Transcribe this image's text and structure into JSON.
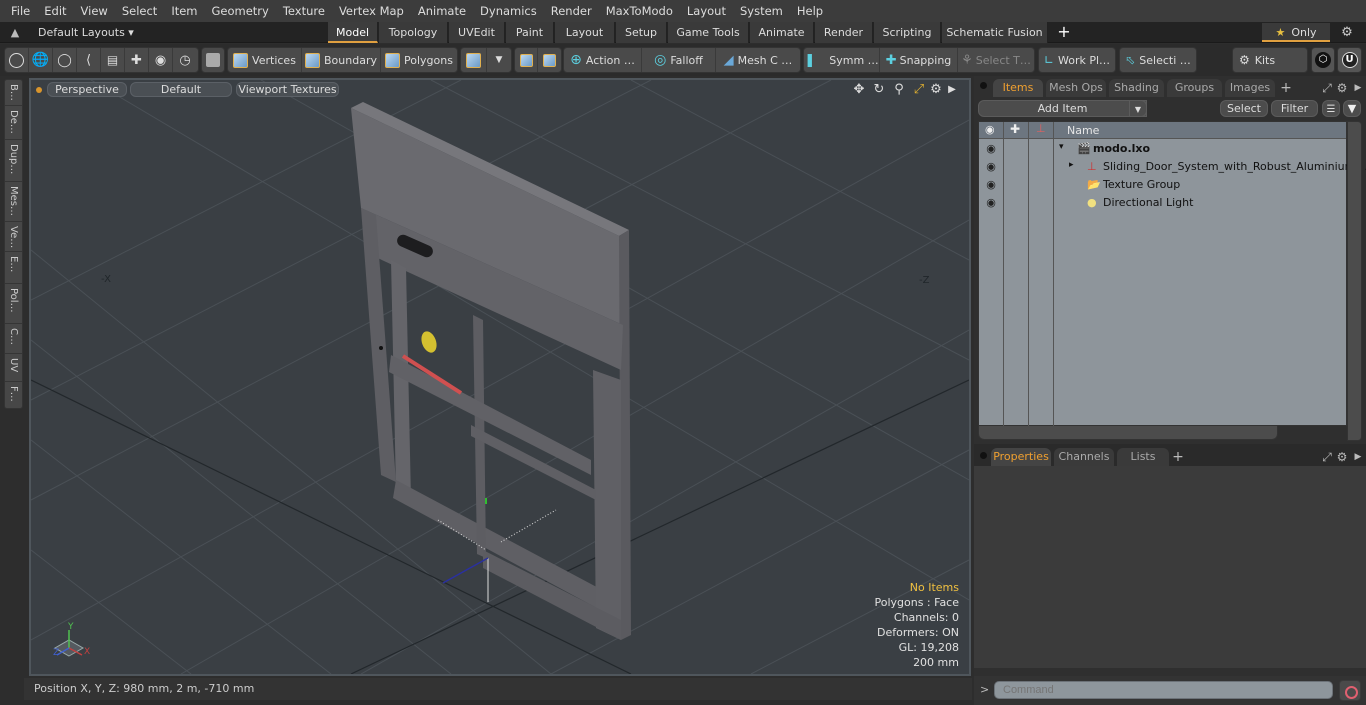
{
  "menubar": {
    "items": [
      "File",
      "Edit",
      "View",
      "Select",
      "Item",
      "Geometry",
      "Texture",
      "Vertex Map",
      "Animate",
      "Dynamics",
      "Render",
      "MaxToModo",
      "Layout",
      "System",
      "Help"
    ]
  },
  "layout_bar": {
    "layouts_dropdown": "Default Layouts ▾",
    "tabs": [
      {
        "label": "Model",
        "active": true
      },
      {
        "label": "Topology"
      },
      {
        "label": "UVEdit"
      },
      {
        "label": "Paint"
      },
      {
        "label": "Layout"
      },
      {
        "label": "Setup"
      },
      {
        "label": "Game Tools"
      },
      {
        "label": "Animate"
      },
      {
        "label": "Render"
      },
      {
        "label": "Scripting"
      },
      {
        "label": "Schematic Fusion"
      }
    ],
    "add_tab": "+",
    "only_label": "Only",
    "star": "★"
  },
  "toolbar": {
    "vertices": "Vertices",
    "boundary": "Boundary",
    "polygons": "Polygons",
    "action": "Action …",
    "falloff": "Falloff",
    "mesh_c": "Mesh C …",
    "symm": "Symm …",
    "snapping": "Snapping",
    "select_t": "Select T…",
    "work_pl": "Work Pl…",
    "selecti": "Selecti …",
    "kits": "Kits"
  },
  "left_tabs": [
    "B…",
    "De…",
    "Dup…",
    "Mes…",
    "Ve…",
    "E…",
    "Pol…",
    "C…",
    "UV",
    "F…"
  ],
  "viewport": {
    "view_mode": "Perspective",
    "shading": "Default",
    "textures": "Viewport Textures",
    "axis_neg_x": "-X",
    "axis_neg_z": "-Z",
    "info": {
      "selection": "No Items",
      "polygons": "Polygons : Face",
      "channels": "Channels: 0",
      "deformers": "Deformers: ON",
      "gl": "GL: 19,208",
      "grid": "200 mm"
    },
    "gizmo": {
      "x": "X",
      "y": "Y",
      "z": "Z"
    }
  },
  "status": {
    "position": "Position X, Y, Z:   980 mm, 2 m, -710 mm"
  },
  "items_panel": {
    "tabs": [
      {
        "label": "Items",
        "active": true
      },
      {
        "label": "Mesh Ops"
      },
      {
        "label": "Shading"
      },
      {
        "label": "Groups"
      },
      {
        "label": "Images"
      }
    ],
    "add_tab": "+",
    "add_item": "Add Item",
    "select": "Select",
    "filter": "Filter",
    "column_name": "Name",
    "rows": [
      {
        "name": "modo.lxo",
        "icon": "scene-icon",
        "bold": true,
        "expander": "▾"
      },
      {
        "name": "Sliding_Door_System_with_Robust_Aluminium_ …",
        "icon": "locator-icon",
        "expander": "▸"
      },
      {
        "name": "Texture Group",
        "icon": "texture-group-icon"
      },
      {
        "name": "Directional Light",
        "icon": "light-icon"
      }
    ]
  },
  "properties_panel": {
    "tabs": [
      {
        "label": "Properties",
        "active": true
      },
      {
        "label": "Channels"
      },
      {
        "label": "Lists"
      }
    ],
    "add_tab": "+"
  },
  "command": {
    "prompt": ">",
    "placeholder": "Command"
  },
  "colors": {
    "accent": "#e0a040",
    "viewport_bg": "#3a3f44",
    "info_highlight": "#f0c040"
  }
}
